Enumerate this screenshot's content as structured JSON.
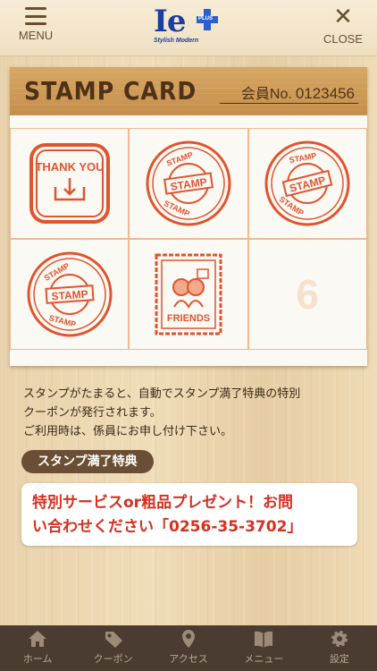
{
  "header": {
    "menu_label": "MENU",
    "close_label": "CLOSE",
    "logo_main": "Ie",
    "logo_badge": "PLUS",
    "logo_sub": "Stylish Modern"
  },
  "card": {
    "title": "STAMP CARD",
    "member_prefix": "会員No.",
    "member_number": "0123456",
    "cells": [
      {
        "type": "thank-you",
        "text": "THANK YOU"
      },
      {
        "type": "stamp",
        "text": "STAMP"
      },
      {
        "type": "stamp",
        "text": "STAMP"
      },
      {
        "type": "stamp",
        "text": "STAMP"
      },
      {
        "type": "friends",
        "text": "FRIENDS"
      },
      {
        "type": "empty",
        "text": "6"
      }
    ]
  },
  "description": {
    "line1": "スタンプがたまると、自動でスタンプ満了特典の特別",
    "line2": "クーポンが発行されます。",
    "line3": "ご利用時は、係員にお申し付け下さい。"
  },
  "reward": {
    "label": "スタンプ満了特典",
    "text_line1": "特別サービスor粗品プレゼント！お問",
    "text_line2": "い合わせください「0256-35-3702」"
  },
  "tabbar": {
    "items": [
      {
        "label": "ホーム",
        "icon": "home-icon"
      },
      {
        "label": "クーポン",
        "icon": "tag-icon"
      },
      {
        "label": "アクセス",
        "icon": "map-pin-icon"
      },
      {
        "label": "メニュー",
        "icon": "book-icon"
      },
      {
        "label": "設定",
        "icon": "gear-icon"
      }
    ]
  },
  "colors": {
    "stamp_red": "#e0542f",
    "tab_bg": "#4b3c31",
    "accent_red": "#d6301f"
  }
}
